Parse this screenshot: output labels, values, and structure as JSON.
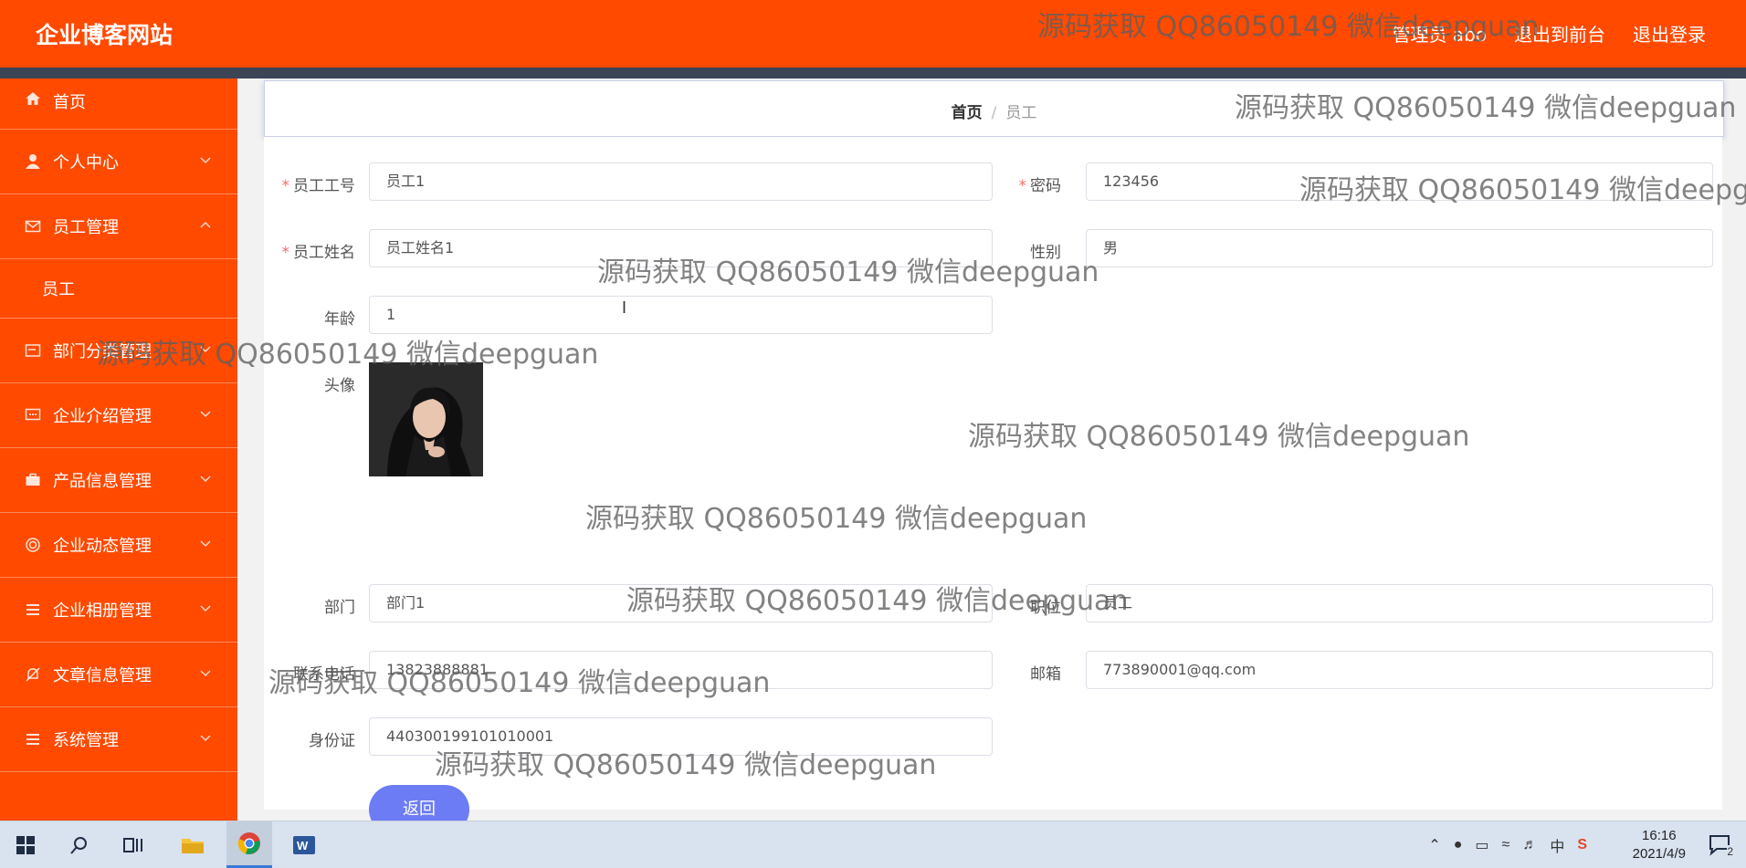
{
  "header": {
    "brand": "企业博客网站",
    "admin_label": "管理员 abo",
    "to_front_label": "退出到前台",
    "logout_label": "退出登录"
  },
  "sidebar": {
    "items": [
      {
        "label": "首页",
        "icon": "home-icon"
      },
      {
        "label": "个人中心",
        "icon": "user-icon"
      },
      {
        "label": "员工管理",
        "icon": "mail-icon",
        "expanded": true
      },
      {
        "label": "部门分类管理",
        "icon": "card-icon"
      },
      {
        "label": "企业介绍管理",
        "icon": "chat-icon"
      },
      {
        "label": "产品信息管理",
        "icon": "briefcase-icon"
      },
      {
        "label": "企业动态管理",
        "icon": "circle-icon"
      },
      {
        "label": "企业相册管理",
        "icon": "list-icon"
      },
      {
        "label": "文章信息管理",
        "icon": "bell-off-icon"
      },
      {
        "label": "系统管理",
        "icon": "list-icon"
      }
    ],
    "sub_item": "员工"
  },
  "breadcrumb": {
    "home": "首页",
    "separator": "/",
    "current": "员工"
  },
  "form": {
    "emp_no_label": "员工工号",
    "emp_no_value": "员工1",
    "password_label": "密码",
    "password_value": "123456",
    "name_label": "员工姓名",
    "name_value": "员工姓名1",
    "gender_label": "性别",
    "gender_value": "男",
    "age_label": "年龄",
    "age_value": "1",
    "avatar_label": "头像",
    "dept_label": "部门",
    "dept_value": "部门1",
    "position_label": "职位",
    "position_value": "员工",
    "phone_label": "联系电话",
    "phone_value": "13823888881",
    "email_label": "邮箱",
    "email_value": "773890001@qq.com",
    "idcard_label": "身份证",
    "idcard_value": "440300199101010001",
    "back_label": "返回"
  },
  "watermark": "源码获取 QQ86050149 微信deepguan",
  "taskbar": {
    "time": "16:16",
    "date": "2021/4/9",
    "ime": "中",
    "notif_count": "2"
  },
  "colors": {
    "brand": "#ff4a00",
    "nav_strip": "#3b4556",
    "button": "#6c7cf5",
    "required": "#f56c6c"
  }
}
